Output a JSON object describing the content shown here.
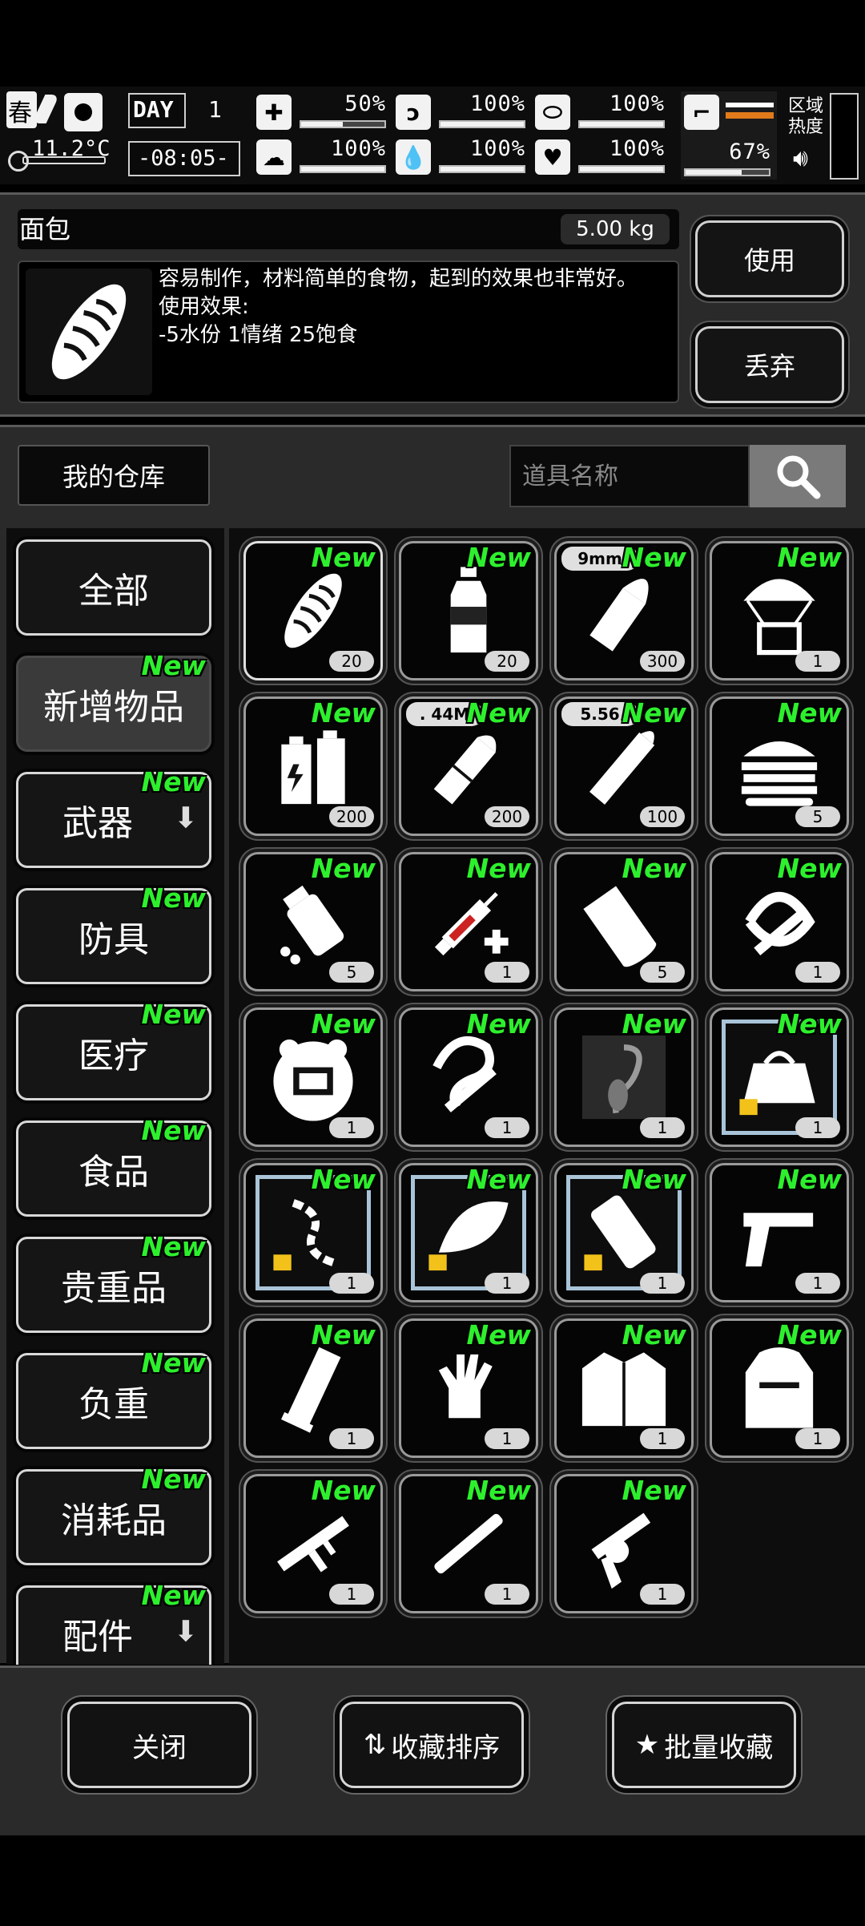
{
  "status": {
    "season": "春",
    "temperature": "11.2°C",
    "day_label": "DAY",
    "day_number": "1",
    "clock": "-08:05-",
    "stats": [
      {
        "name": "health",
        "icon": "medkit-icon",
        "value": "50%",
        "fraction": 0.5
      },
      {
        "name": "hunger",
        "icon": "stomach-icon",
        "value": "100%",
        "fraction": 1.0
      },
      {
        "name": "energy",
        "icon": "pill-icon",
        "value": "100%",
        "fraction": 1.0
      },
      {
        "name": "mental",
        "icon": "brain-icon",
        "value": "100%",
        "fraction": 1.0
      },
      {
        "name": "thirst",
        "icon": "water-drop-icon",
        "value": "100%",
        "fraction": 1.0
      },
      {
        "name": "mood",
        "icon": "heart-icon",
        "value": "100%",
        "fraction": 1.0
      }
    ],
    "stamina_value": "67%",
    "stamina_fraction": 0.67,
    "zone_label": "区域热度"
  },
  "item": {
    "name": "面包",
    "weight": "5.00 kg",
    "description_lines": [
      "容易制作，材料简单的食物，起到的效果也非常好。",
      "使用效果:",
      "-5水份 1情绪 25饱食"
    ],
    "use_label": "使用",
    "discard_label": "丢弃"
  },
  "warehouse": {
    "title": "我的仓库",
    "search_placeholder": "道具名称",
    "new_label": "New",
    "categories": [
      {
        "label": "全部",
        "is_new": false,
        "arrow": false
      },
      {
        "label": "新增物品",
        "is_new": true,
        "arrow": false,
        "active": true
      },
      {
        "label": "武器",
        "is_new": true,
        "arrow": true
      },
      {
        "label": "防具",
        "is_new": true,
        "arrow": false
      },
      {
        "label": "医疗",
        "is_new": true,
        "arrow": false
      },
      {
        "label": "食品",
        "is_new": true,
        "arrow": false
      },
      {
        "label": "贵重品",
        "is_new": true,
        "arrow": false
      },
      {
        "label": "负重",
        "is_new": true,
        "arrow": false
      },
      {
        "label": "消耗品",
        "is_new": true,
        "arrow": false
      },
      {
        "label": "配件",
        "is_new": true,
        "arrow": true
      }
    ],
    "items": [
      {
        "icon": "bread-icon",
        "qty": "20",
        "selected": true
      },
      {
        "icon": "water-bottle-icon",
        "qty": "20"
      },
      {
        "icon": "bullet-icon",
        "qty": "300",
        "caliber": "9mm"
      },
      {
        "icon": "airdrop-icon",
        "qty": "1"
      },
      {
        "icon": "battery-icon",
        "qty": "200"
      },
      {
        "icon": "cartridge-icon",
        "qty": "200",
        "caliber": ". 44M"
      },
      {
        "icon": "rifle-round-icon",
        "qty": "100",
        "caliber": "5.56"
      },
      {
        "icon": "burger-icon",
        "qty": "5"
      },
      {
        "icon": "pill-bottle-icon",
        "qty": "5"
      },
      {
        "icon": "syringe-icon",
        "qty": "1"
      },
      {
        "icon": "bandage-roll-icon",
        "qty": "5"
      },
      {
        "icon": "rope-flute-icon",
        "qty": "1"
      },
      {
        "icon": "bear-badge-icon",
        "qty": "1"
      },
      {
        "icon": "tentacle-flute-icon",
        "qty": "1"
      },
      {
        "icon": "scorpion-icon",
        "qty": "1"
      },
      {
        "icon": "duffel-bag-icon",
        "qty": "1",
        "rare": true
      },
      {
        "icon": "chain-icon",
        "qty": "1",
        "rare": true
      },
      {
        "icon": "feather-icon",
        "qty": "1",
        "rare": true
      },
      {
        "icon": "cylinder-icon",
        "qty": "1",
        "rare": true
      },
      {
        "icon": "pistol-icon",
        "qty": "1"
      },
      {
        "icon": "magazine-icon",
        "qty": "1"
      },
      {
        "icon": "glove-icon",
        "qty": "1"
      },
      {
        "icon": "jacket-icon",
        "qty": "1"
      },
      {
        "icon": "backpack-icon",
        "qty": "1"
      },
      {
        "icon": "smg-icon",
        "qty": "1"
      },
      {
        "icon": "stick-icon",
        "qty": "1"
      },
      {
        "icon": "revolver-icon",
        "qty": "1"
      }
    ]
  },
  "footer": {
    "close_label": "关闭",
    "sort_label": "收藏排序",
    "batch_label": "批量收藏"
  }
}
